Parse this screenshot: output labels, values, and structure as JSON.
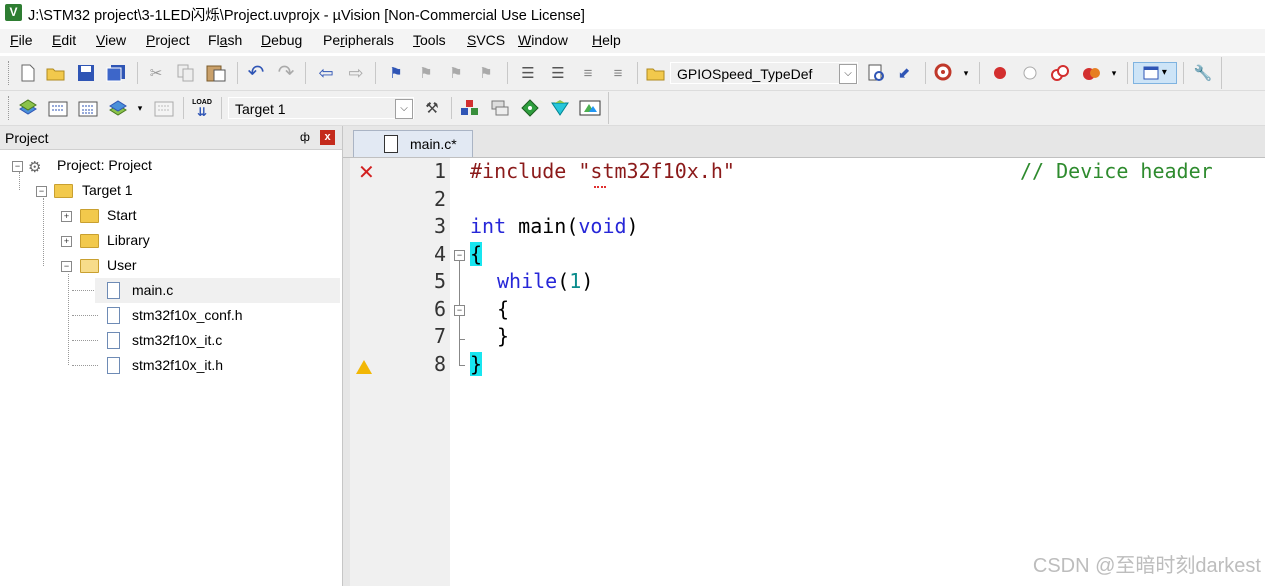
{
  "window": {
    "title": "J:\\STM32 project\\3-1LED闪烁\\Project.uvprojx - µVision  [Non-Commercial Use License]",
    "logo_letter": "V"
  },
  "menu": {
    "items": [
      {
        "accel": "F",
        "rest": "ile"
      },
      {
        "accel": "E",
        "rest": "dit"
      },
      {
        "accel": "V",
        "rest": "iew"
      },
      {
        "accel": "P",
        "rest": "roject"
      },
      {
        "pre": "Fl",
        "accel": "a",
        "rest": "sh"
      },
      {
        "accel": "D",
        "rest": "ebug"
      },
      {
        "pre": "Pe",
        "accel": "r",
        "rest": "ipherals"
      },
      {
        "accel": "T",
        "rest": "ools"
      },
      {
        "accel": "S",
        "rest": "VCS"
      },
      {
        "accel": "W",
        "rest": "indow"
      },
      {
        "accel": "H",
        "rest": "elp"
      }
    ]
  },
  "toolbar1": {
    "find_combo_value": "GPIOSpeed_TypeDef"
  },
  "toolbar2": {
    "target_combo_value": "Target 1",
    "load_label": "LOAD"
  },
  "project_panel": {
    "title": "Project",
    "pin_glyph": "ф",
    "close_glyph": "x",
    "tree": {
      "root": "Project: Project",
      "target": "Target 1",
      "groups": [
        "Start",
        "Library",
        "User"
      ],
      "user_files": [
        "main.c",
        "stm32f10x_conf.h",
        "stm32f10x_it.c",
        "stm32f10x_it.h"
      ]
    }
  },
  "editor": {
    "tab_label": "main.c*",
    "line_numbers": [
      "1",
      "2",
      "3",
      "4",
      "5",
      "6",
      "7",
      "8"
    ],
    "code": {
      "l1_directive": "#include ",
      "l1_header": "\"stm32f10x.h\"",
      "l1_comment": "// Device header",
      "l3_int": "int",
      "l3_main": " main(",
      "l3_void": "void",
      "l3_close": ")",
      "l4_brace": "{",
      "l5_while": "while",
      "l5_open": "(",
      "l5_num": "1",
      "l5_close": ")",
      "l6_brace": "{",
      "l7_brace": "}",
      "l8_brace": "}"
    }
  },
  "watermark": "CSDN @至暗时刻darkest",
  "colors": {
    "keyword": "#2727d8",
    "number": "#0a8c8c",
    "comment": "#2e8b2e",
    "brace_highlight": "#18e6f0",
    "error": "#d22020",
    "warning": "#f2b705"
  }
}
